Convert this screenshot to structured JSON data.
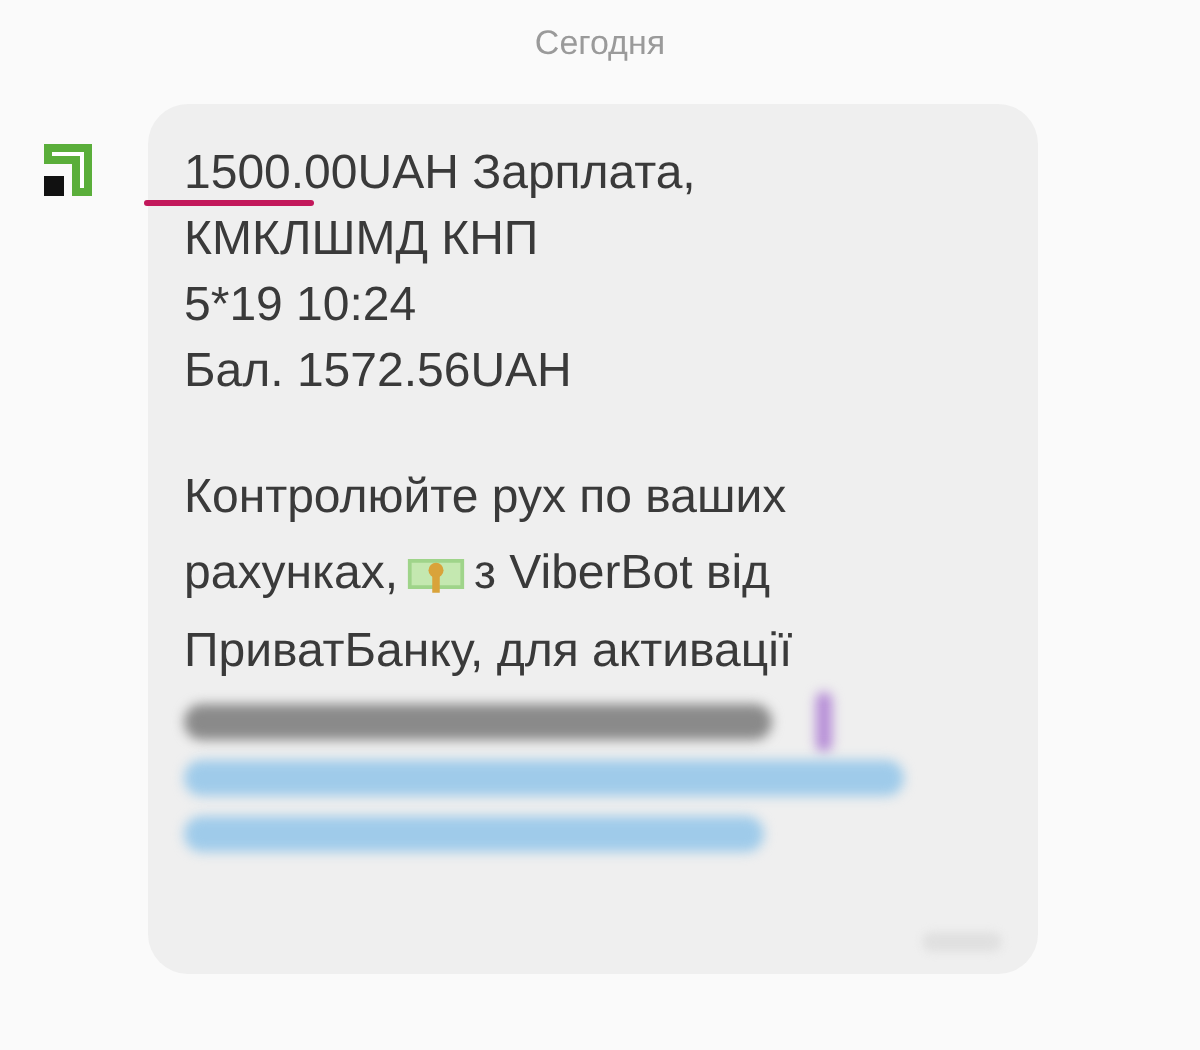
{
  "date_divider": "Сегодня",
  "message": {
    "paragraphs": [
      {
        "lines": [
          {
            "text": "1500.00UAH Зарплата,",
            "underlined": true
          },
          {
            "text": "КМКЛШМД КНП"
          },
          {
            "text": "5*19 10:24"
          },
          {
            "text": "Бал. 1572.56UAH"
          }
        ]
      },
      {
        "lines": [
          {
            "text": "Контролюйте рух по ваших"
          },
          {
            "text": "рахунках,",
            "after_icon": "з ViberBot від"
          },
          {
            "text": "ПриватБанку, для активації"
          }
        ]
      }
    ],
    "blurred_lines": [
      {
        "kind": "text"
      },
      {
        "kind": "link"
      },
      {
        "kind": "link"
      }
    ]
  }
}
